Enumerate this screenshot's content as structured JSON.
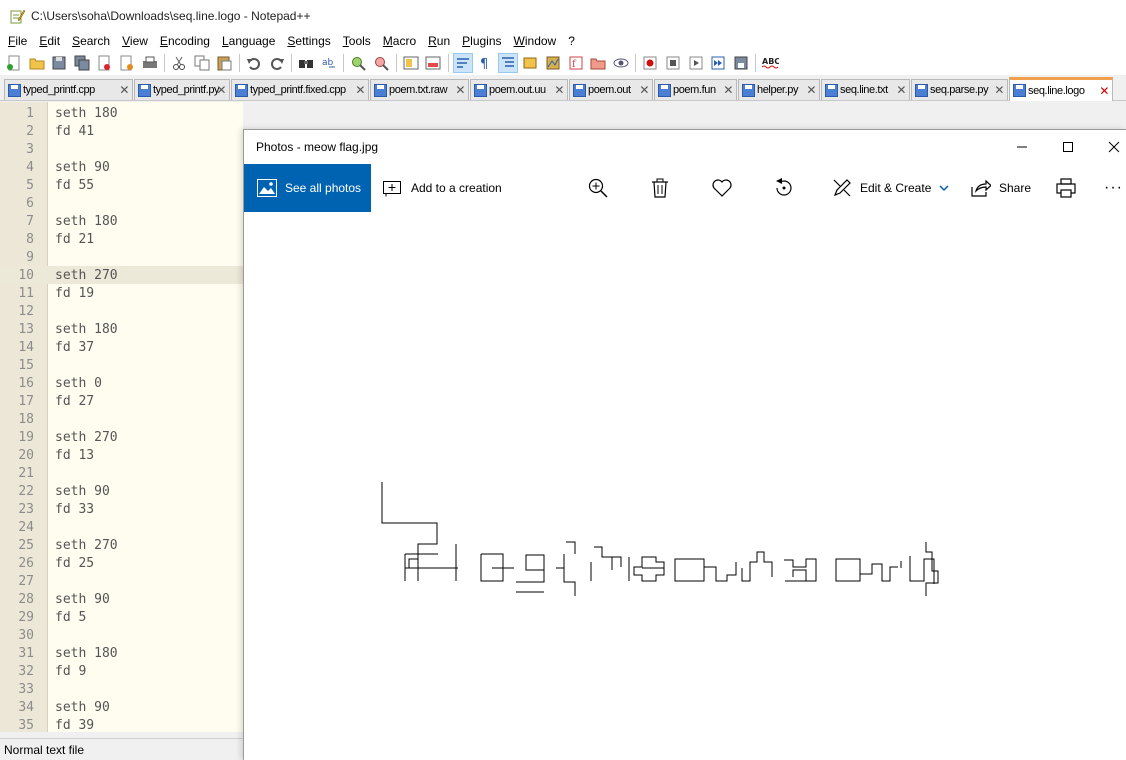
{
  "notepad": {
    "title": "C:\\Users\\soha\\Downloads\\seq.line.logo - Notepad++",
    "menu": [
      "File",
      "Edit",
      "Search",
      "View",
      "Encoding",
      "Language",
      "Settings",
      "Tools",
      "Macro",
      "Run",
      "Plugins",
      "Window",
      "?"
    ],
    "tabs": [
      {
        "label": "typed_printf.cpp",
        "close": "✕"
      },
      {
        "label": "typed_printf.py",
        "close": "✕"
      },
      {
        "label": "typed_printf.fixed.cpp",
        "close": "✕"
      },
      {
        "label": "poem.txt.raw",
        "close": "✕"
      },
      {
        "label": "poem.out.uu",
        "close": "✕"
      },
      {
        "label": "poem.out",
        "close": "✕"
      },
      {
        "label": "poem.fun",
        "close": "✕"
      },
      {
        "label": "helper.py",
        "close": "✕"
      },
      {
        "label": "seq.line.txt",
        "close": "✕"
      },
      {
        "label": "seq.parse.py",
        "close": "✕"
      },
      {
        "label": "seq.line.logo",
        "close": "✕"
      }
    ],
    "active_tab": 10,
    "current_line": 10,
    "lines": [
      "seth 180",
      "fd 41",
      "",
      "seth 90",
      "fd 55",
      "",
      "seth 180",
      "fd 21",
      "",
      "seth 270",
      "fd 19",
      "",
      "seth 180",
      "fd 37",
      "",
      "seth 0",
      "fd 27",
      "",
      "seth 270",
      "fd 13",
      "",
      "seth 90",
      "fd 33",
      "",
      "seth 270",
      "fd 25",
      "",
      "seth 90",
      "fd 5",
      "",
      "seth 180",
      "fd 9",
      "",
      "seth 90",
      "fd 39"
    ],
    "status": "Normal text file"
  },
  "photos": {
    "title": "Photos - meow flag.jpg",
    "see_all": "See all photos",
    "add_creation": "Add to a creation",
    "edit_create": "Edit & Create",
    "share": "Share",
    "more": "···"
  },
  "colors": {
    "accent_blue": "#0063b1",
    "editor_bg": "#fffdf0",
    "active_tab_accent": "#f0a04b"
  }
}
